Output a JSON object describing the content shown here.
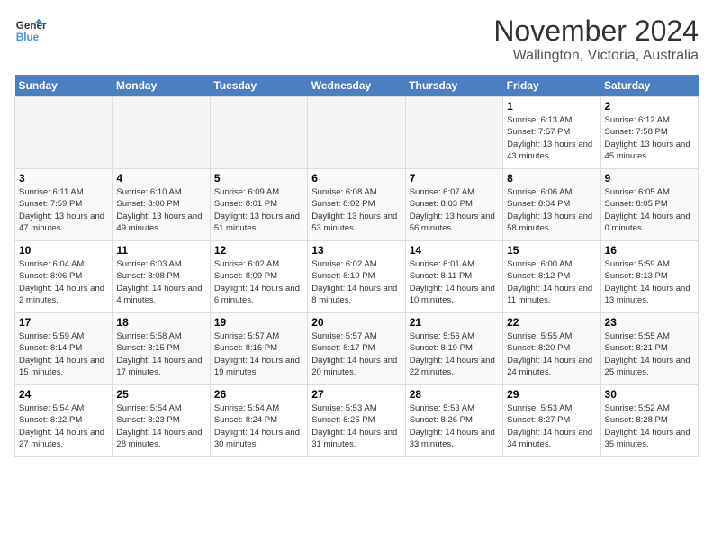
{
  "header": {
    "logo_line1": "General",
    "logo_line2": "Blue",
    "month_title": "November 2024",
    "location": "Wallington, Victoria, Australia"
  },
  "calendar": {
    "days_of_week": [
      "Sunday",
      "Monday",
      "Tuesday",
      "Wednesday",
      "Thursday",
      "Friday",
      "Saturday"
    ],
    "weeks": [
      [
        {
          "day": "",
          "empty": true
        },
        {
          "day": "",
          "empty": true
        },
        {
          "day": "",
          "empty": true
        },
        {
          "day": "",
          "empty": true
        },
        {
          "day": "",
          "empty": true
        },
        {
          "day": "1",
          "sunrise": "6:13 AM",
          "sunset": "7:57 PM",
          "daylight": "13 hours and 43 minutes."
        },
        {
          "day": "2",
          "sunrise": "6:12 AM",
          "sunset": "7:58 PM",
          "daylight": "13 hours and 45 minutes."
        }
      ],
      [
        {
          "day": "3",
          "sunrise": "6:11 AM",
          "sunset": "7:59 PM",
          "daylight": "13 hours and 47 minutes."
        },
        {
          "day": "4",
          "sunrise": "6:10 AM",
          "sunset": "8:00 PM",
          "daylight": "13 hours and 49 minutes."
        },
        {
          "day": "5",
          "sunrise": "6:09 AM",
          "sunset": "8:01 PM",
          "daylight": "13 hours and 51 minutes."
        },
        {
          "day": "6",
          "sunrise": "6:08 AM",
          "sunset": "8:02 PM",
          "daylight": "13 hours and 53 minutes."
        },
        {
          "day": "7",
          "sunrise": "6:07 AM",
          "sunset": "8:03 PM",
          "daylight": "13 hours and 56 minutes."
        },
        {
          "day": "8",
          "sunrise": "6:06 AM",
          "sunset": "8:04 PM",
          "daylight": "13 hours and 58 minutes."
        },
        {
          "day": "9",
          "sunrise": "6:05 AM",
          "sunset": "8:05 PM",
          "daylight": "14 hours and 0 minutes."
        }
      ],
      [
        {
          "day": "10",
          "sunrise": "6:04 AM",
          "sunset": "8:06 PM",
          "daylight": "14 hours and 2 minutes."
        },
        {
          "day": "11",
          "sunrise": "6:03 AM",
          "sunset": "8:08 PM",
          "daylight": "14 hours and 4 minutes."
        },
        {
          "day": "12",
          "sunrise": "6:02 AM",
          "sunset": "8:09 PM",
          "daylight": "14 hours and 6 minutes."
        },
        {
          "day": "13",
          "sunrise": "6:02 AM",
          "sunset": "8:10 PM",
          "daylight": "14 hours and 8 minutes."
        },
        {
          "day": "14",
          "sunrise": "6:01 AM",
          "sunset": "8:11 PM",
          "daylight": "14 hours and 10 minutes."
        },
        {
          "day": "15",
          "sunrise": "6:00 AM",
          "sunset": "8:12 PM",
          "daylight": "14 hours and 11 minutes."
        },
        {
          "day": "16",
          "sunrise": "5:59 AM",
          "sunset": "8:13 PM",
          "daylight": "14 hours and 13 minutes."
        }
      ],
      [
        {
          "day": "17",
          "sunrise": "5:59 AM",
          "sunset": "8:14 PM",
          "daylight": "14 hours and 15 minutes."
        },
        {
          "day": "18",
          "sunrise": "5:58 AM",
          "sunset": "8:15 PM",
          "daylight": "14 hours and 17 minutes."
        },
        {
          "day": "19",
          "sunrise": "5:57 AM",
          "sunset": "8:16 PM",
          "daylight": "14 hours and 19 minutes."
        },
        {
          "day": "20",
          "sunrise": "5:57 AM",
          "sunset": "8:17 PM",
          "daylight": "14 hours and 20 minutes."
        },
        {
          "day": "21",
          "sunrise": "5:56 AM",
          "sunset": "8:19 PM",
          "daylight": "14 hours and 22 minutes."
        },
        {
          "day": "22",
          "sunrise": "5:55 AM",
          "sunset": "8:20 PM",
          "daylight": "14 hours and 24 minutes."
        },
        {
          "day": "23",
          "sunrise": "5:55 AM",
          "sunset": "8:21 PM",
          "daylight": "14 hours and 25 minutes."
        }
      ],
      [
        {
          "day": "24",
          "sunrise": "5:54 AM",
          "sunset": "8:22 PM",
          "daylight": "14 hours and 27 minutes."
        },
        {
          "day": "25",
          "sunrise": "5:54 AM",
          "sunset": "8:23 PM",
          "daylight": "14 hours and 28 minutes."
        },
        {
          "day": "26",
          "sunrise": "5:54 AM",
          "sunset": "8:24 PM",
          "daylight": "14 hours and 30 minutes."
        },
        {
          "day": "27",
          "sunrise": "5:53 AM",
          "sunset": "8:25 PM",
          "daylight": "14 hours and 31 minutes."
        },
        {
          "day": "28",
          "sunrise": "5:53 AM",
          "sunset": "8:26 PM",
          "daylight": "14 hours and 33 minutes."
        },
        {
          "day": "29",
          "sunrise": "5:53 AM",
          "sunset": "8:27 PM",
          "daylight": "14 hours and 34 minutes."
        },
        {
          "day": "30",
          "sunrise": "5:52 AM",
          "sunset": "8:28 PM",
          "daylight": "14 hours and 35 minutes."
        }
      ]
    ]
  }
}
